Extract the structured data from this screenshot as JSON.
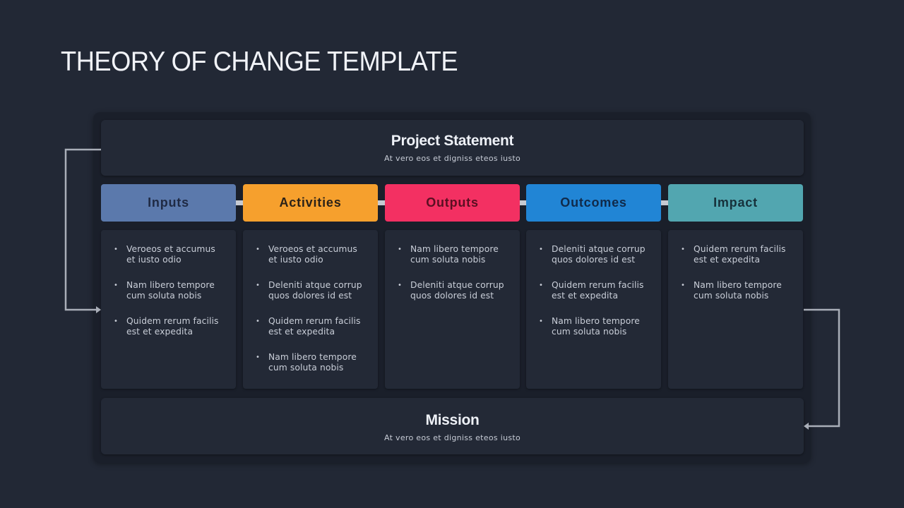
{
  "title": "THEORY OF CHANGE TEMPLATE",
  "project_statement": {
    "title": "Project Statement",
    "subtitle": "At vero eos et digniss eteos iusto"
  },
  "stages": [
    {
      "label": "Inputs",
      "color": "#5b79ac",
      "text_color": "#1f2a44",
      "items": [
        "Veroeos et accumus et iusto odio",
        "Nam libero tempore cum soluta nobis",
        "Quidem rerum facilis est et expedita"
      ]
    },
    {
      "label": "Activities",
      "color": "#f6a02d",
      "text_color": "#2b2218",
      "items": [
        "Veroeos et accumus et iusto odio",
        "Deleniti atque corrup quos dolores id est",
        "Quidem rerum facilis est et expedita",
        "Nam libero tempore cum soluta nobis"
      ]
    },
    {
      "label": "Outputs",
      "color": "#f33062",
      "text_color": "#5a0f22",
      "items": [
        "Nam libero tempore cum soluta nobis",
        "Deleniti atque corrup quos dolores id est"
      ]
    },
    {
      "label": "Outcomes",
      "color": "#2185d5",
      "text_color": "#102a4a",
      "items": [
        "Deleniti atque corrup quos dolores id est",
        "Quidem rerum facilis est et expedita",
        "Nam libero tempore cum soluta nobis"
      ]
    },
    {
      "label": "Impact",
      "color": "#52a6b0",
      "text_color": "#16303a",
      "items": [
        "Quidem rerum facilis est et expedita",
        "Nam libero tempore cum soluta nobis"
      ]
    }
  ],
  "mission": {
    "title": "Mission",
    "subtitle": "At vero eos et digniss eteos iusto"
  },
  "icons": {
    "bullet": "•",
    "feedback_arrow_left": "arrow-right-icon",
    "feedback_arrow_right": "arrow-left-icon"
  }
}
